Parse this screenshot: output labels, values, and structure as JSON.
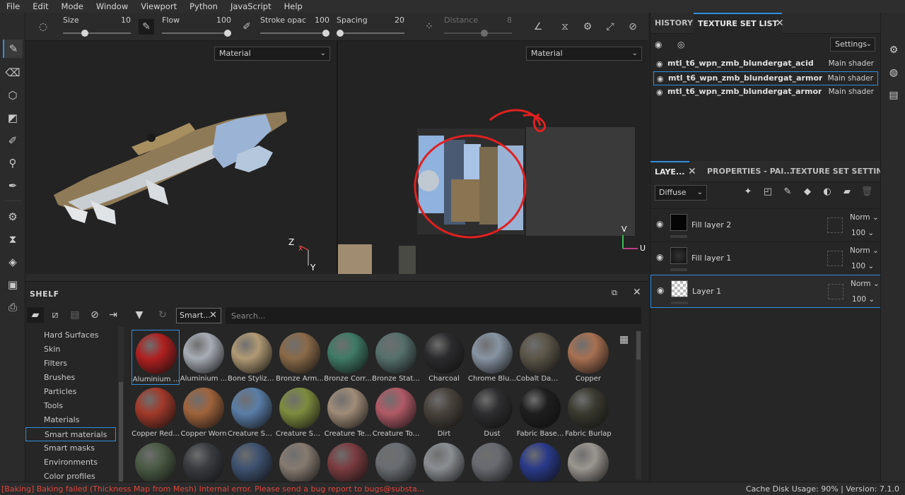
{
  "menu": [
    "File",
    "Edit",
    "Mode",
    "Window",
    "Viewport",
    "Python",
    "JavaScript",
    "Help"
  ],
  "left_tools": [
    "paint-brush-icon",
    "eraser-icon",
    "projection-icon",
    "polygon-fill-icon",
    "smudge-icon",
    "clone-icon",
    "color-picker-icon",
    "bake-icon",
    "history-icon",
    "iray-icon",
    "photoshop-icon",
    "export-icon"
  ],
  "context_bar": {
    "size": {
      "label": "Size",
      "value": "10",
      "fraction": 0.17
    },
    "flow": {
      "label": "Flow",
      "value": "100",
      "fraction": 1.0
    },
    "stroke_opacity": {
      "label": "Stroke opac",
      "value": "100",
      "fraction": 1.0
    },
    "spacing": {
      "label": "Spacing",
      "value": "20",
      "fraction": 0.0
    },
    "distance": {
      "label": "Distance",
      "value": "8",
      "fraction": 0.55
    }
  },
  "viewport3d": {
    "channel": "Material",
    "axis_z": "Z",
    "axis_x": "X",
    "axis_y": "Y"
  },
  "viewport2d": {
    "channel": "Material",
    "axis_v": "V",
    "axis_u": "U"
  },
  "shelf": {
    "title": "SHELF",
    "filter_tag": "Smart...",
    "search_placeholder": "Search...",
    "categories": [
      "Hard Surfaces",
      "Skin",
      "Filters",
      "Brushes",
      "Particles",
      "Tools",
      "Materials",
      "Smart materials",
      "Smart masks",
      "Environments",
      "Color profiles"
    ],
    "selected_category": "Smart materials",
    "materials": [
      {
        "name": "Aluminium ...",
        "color": "#b02020"
      },
      {
        "name": "Aluminium ...",
        "color": "#a8adb5"
      },
      {
        "name": "Bone Stylized",
        "color": "#b09a74"
      },
      {
        "name": "Bronze Arm...",
        "color": "#8a6a48"
      },
      {
        "name": "Bronze Corr...",
        "color": "#3f7a66"
      },
      {
        "name": "Bronze Stat...",
        "color": "#56706c"
      },
      {
        "name": "Charcoal",
        "color": "#2b2b2d"
      },
      {
        "name": "Chrome Blu...",
        "color": "#8894a3"
      },
      {
        "name": "Cobalt Dam...",
        "color": "#5b5548"
      },
      {
        "name": "Copper",
        "color": "#a87052"
      },
      {
        "name": "Copper Red...",
        "color": "#a23a2a"
      },
      {
        "name": "Copper Worn",
        "color": "#a0643c"
      },
      {
        "name": "Creature Ski...",
        "color": "#5a7ea8"
      },
      {
        "name": "Creature Ski...",
        "color": "#7e8c3e"
      },
      {
        "name": "Creature Te...",
        "color": "#a08c78"
      },
      {
        "name": "Creature To...",
        "color": "#b05a66"
      },
      {
        "name": "Dirt",
        "color": "#48423c"
      },
      {
        "name": "Dust",
        "color": "#2e2e30"
      },
      {
        "name": "Fabric Base...",
        "color": "#1e1e1e"
      },
      {
        "name": "Fabric Burlap",
        "color": "#3a3a30"
      },
      {
        "name": "",
        "color": "#4a5a44"
      },
      {
        "name": "",
        "color": "#3a3c40"
      },
      {
        "name": "",
        "color": "#3e5270"
      },
      {
        "name": "",
        "color": "#867a70"
      },
      {
        "name": "",
        "color": "#7a3c40"
      },
      {
        "name": "",
        "color": "#6a6e72"
      },
      {
        "name": "",
        "color": "#8a8e92"
      },
      {
        "name": "",
        "color": "#686a70"
      },
      {
        "name": "",
        "color": "#2a3a8a"
      },
      {
        "name": "",
        "color": "#9a9690"
      }
    ]
  },
  "texture_panel": {
    "tabs": [
      "HISTORY",
      "TEXTURE SET LIST"
    ],
    "settings_label": "Settings",
    "sets": [
      {
        "name": "mtl_t6_wpn_zmb_blundergat_acid",
        "shader": "Main shader"
      },
      {
        "name": "mtl_t6_wpn_zmb_blundergat_armor",
        "shader": "Main shader"
      },
      {
        "name": "mtl_t6_wpn_zmb_blundergat_armor_",
        "shader": "Main shader"
      }
    ]
  },
  "layers_panel": {
    "tabs": [
      "LAYE...",
      "PROPERTIES - PAI...",
      "TEXTURE SET SETTIN..."
    ],
    "channel": "Diffuse",
    "layers": [
      {
        "name": "Fill layer 2",
        "blend": "Norm",
        "opacity": "100"
      },
      {
        "name": "Fill layer 1",
        "blend": "Norm",
        "opacity": "100"
      },
      {
        "name": "Layer 1",
        "blend": "Norm",
        "opacity": "100"
      }
    ]
  },
  "status": {
    "message": "[Baking] Baking failed (Thickness Map from Mesh) Internal error. Please send a bug report to bugs@substa...",
    "cache": "Cache Disk Usage:    90% | Version: 7.1.0"
  }
}
